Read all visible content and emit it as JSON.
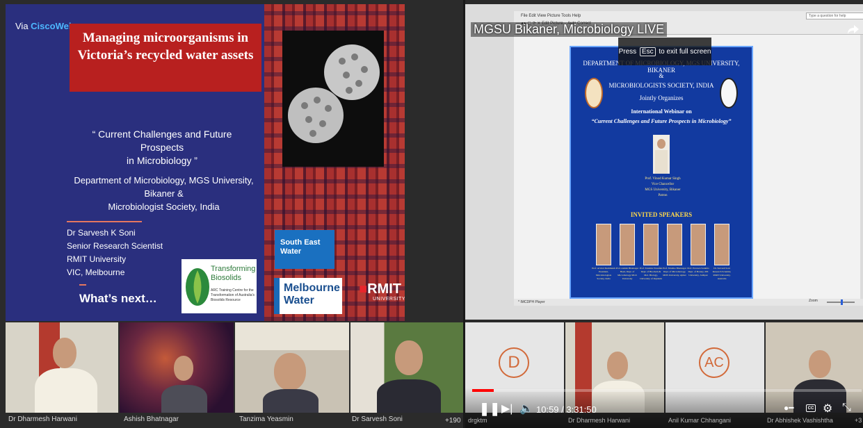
{
  "left_panel": {
    "via_label": "Via ",
    "via_brand": "CiscoWebex",
    "slide": {
      "title": "Managing microorganisms in Victoria’s recycled water assets",
      "subtitle_line1": "“ Current Challenges and Future Prospects",
      "subtitle_line2": "in Microbiology ”",
      "dept_line1": "Department of Microbiology, MGS University, Bikaner &",
      "dept_line2": "Microbiologist Society, India",
      "speaker_name": "Dr Sarvesh K Soni",
      "speaker_role": "Senior Research Scientist",
      "speaker_org": "RMIT University",
      "speaker_loc": "VIC, Melbourne",
      "whats_next": "What’s next…",
      "logo_transforming_1": "Transforming",
      "logo_transforming_2": "Biosolids",
      "logo_transforming_sub": "ARC Training Centre for the Transformation of Australia's Biosolids Resource",
      "logo_sew_1": "South East",
      "logo_sew_2": "Water",
      "logo_mw_1": "Melbourne",
      "logo_mw_2": "Water",
      "logo_rmit": "RMIT",
      "logo_rmit_sub": "UNIVERSITY"
    },
    "participants": [
      {
        "name": "Dr Dharmesh Harwani"
      },
      {
        "name": "Ashish Bhatnagar"
      },
      {
        "name": "Tanzima Yeasmin"
      },
      {
        "name": "Dr Sarvesh Soni"
      }
    ],
    "more_count": "+190"
  },
  "right_panel": {
    "video_title": "MGSU Bikaner, Microbiology LIVE",
    "esc_prefix": "Press",
    "esc_key": "Esc",
    "esc_suffix": "to exit full screen",
    "viewer": {
      "menu": "File   Edit   View   Picture   Tools   Help",
      "toolbar": "◂  ▸  ▢  ⟳  ✕     Edit Picture...    Auto Correct",
      "search_placeholder": "Type a question for help",
      "status_left": "* IMCDPH Player",
      "zoom_label": "Zoom"
    },
    "flyer": {
      "dept": "DEPARTMENT OF MICROBIOLOGY, MGS UNIVERSITY, BIKANER",
      "amp": "&",
      "society": "MICROBIOLOGISTS SOCIETY, INDIA",
      "jointly": "Jointly Organizes",
      "intl": "International Webinar on",
      "topic": "“Current Challenges and Future Prospects in Microbiology”",
      "patron_name": "Prof. Vinod Kumar Singh",
      "patron_title": "Vice Chancellor",
      "patron_org": "MGS University, Bikaner",
      "patron_role": "Patron",
      "invited": "INVITED SPEAKERS",
      "speakers": [
        {
          "caption": "Prof. Arvind Deshmukh President, Microbiologists Society, India"
        },
        {
          "caption": "Prof. Ashish Bhatnagar Head, Dept. of Microbiology MGS University"
        },
        {
          "caption": "Prof. Tanzima Yeasmin Dept. of Biochem & Mol. Biology, University of Rajshahi"
        },
        {
          "caption": "Prof. Monika Bhatnagar Dept. of Microbiology, MDS University, Ajmer"
        },
        {
          "caption": "Prof. Praveen Sankhla Dept. of Botany, MS University, Jodhpur"
        },
        {
          "caption": "Dr. Sarvesh Soni Research Scientist, RMIT University, Australia"
        }
      ]
    },
    "participants": [
      {
        "name": "drgktm",
        "initial": "D"
      },
      {
        "name": "Dr Dharmesh Harwani",
        "initial": ""
      },
      {
        "name": "Anil Kumar Chhangani",
        "initial": "AC"
      },
      {
        "name": "Dr Abhishek Vashishtha",
        "initial": ""
      }
    ],
    "more_count": "+3",
    "player": {
      "time": "10:59 / 3:31:50",
      "progress_fraction": 0.055,
      "cc_label": "CC"
    }
  },
  "colors": {
    "slide_blue": "#2a2f7e",
    "title_red": "#b8201f",
    "webex_blue": "#4db8ff",
    "youtube_red": "#ff0000"
  }
}
